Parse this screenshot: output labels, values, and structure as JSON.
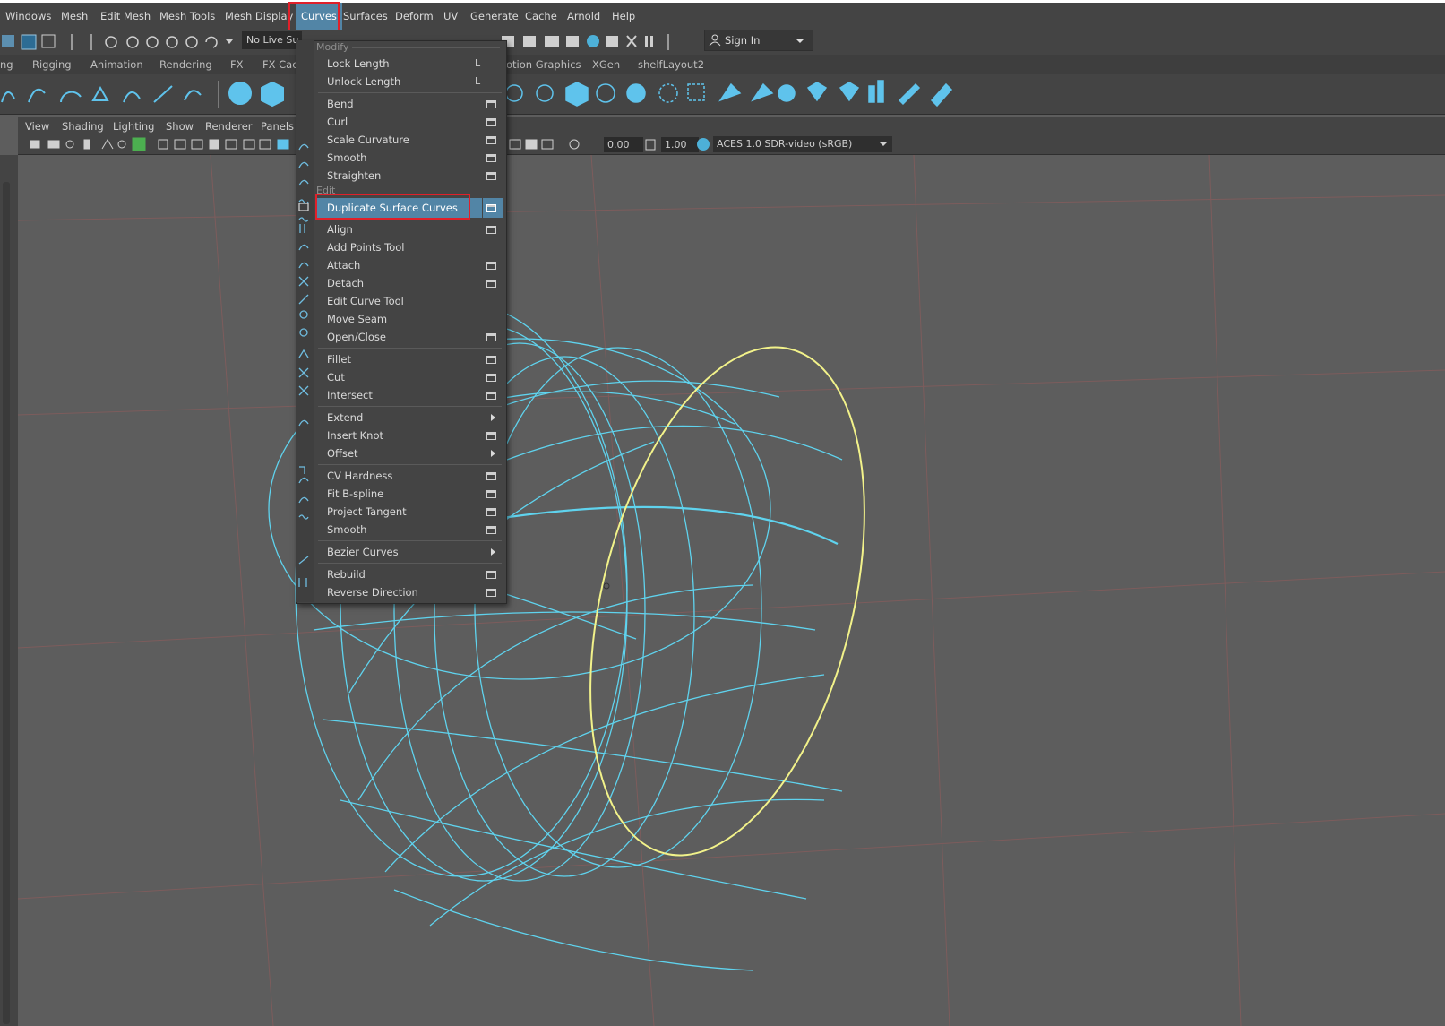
{
  "menubar": {
    "items": [
      "Windows",
      "Mesh",
      "Edit Mesh",
      "Mesh Tools",
      "Mesh Display",
      "Curves",
      "Surfaces",
      "Deform",
      "UV",
      "Generate",
      "Cache",
      "Arnold",
      "Help"
    ],
    "active": "Curves"
  },
  "status_line": {
    "live_surface": "No Live Su",
    "sign_in": "Sign In"
  },
  "shelf_tabs": [
    "ng",
    "Rigging",
    "Animation",
    "Rendering",
    "FX",
    "FX Cach",
    "otion Graphics",
    "XGen",
    "shelfLayout2"
  ],
  "panel_menu": [
    "View",
    "Shading",
    "Lighting",
    "Show",
    "Renderer",
    "Panels"
  ],
  "panel_toolbar": {
    "exposure": "0.00",
    "gamma": "1.00",
    "color_space": "ACES 1.0 SDR-video (sRGB)"
  },
  "curves_menu": {
    "section_modify": "Modify",
    "section_edit": "Edit",
    "items": [
      {
        "label": "Lock Length",
        "key": "L"
      },
      {
        "label": "Unlock Length",
        "key": "L"
      },
      {
        "label": "Bend"
      },
      {
        "label": "Curl"
      },
      {
        "label": "Scale Curvature"
      },
      {
        "label": "Smooth"
      },
      {
        "label": "Straighten"
      },
      {
        "label": "Duplicate Surface Curves"
      },
      {
        "label": "Align"
      },
      {
        "label": "Add Points Tool"
      },
      {
        "label": "Attach"
      },
      {
        "label": "Detach"
      },
      {
        "label": "Edit Curve Tool"
      },
      {
        "label": "Move Seam"
      },
      {
        "label": "Open/Close"
      },
      {
        "label": "Fillet"
      },
      {
        "label": "Cut"
      },
      {
        "label": "Intersect"
      },
      {
        "label": "Extend"
      },
      {
        "label": "Insert Knot"
      },
      {
        "label": "Offset"
      },
      {
        "label": "CV Hardness"
      },
      {
        "label": "Fit B-spline"
      },
      {
        "label": "Project Tangent"
      },
      {
        "label": "Smooth"
      },
      {
        "label": "Bezier Curves"
      },
      {
        "label": "Rebuild"
      },
      {
        "label": "Reverse Direction"
      }
    ],
    "highlighted": "Duplicate Surface Curves"
  },
  "colors": {
    "highlight": "#5285a6",
    "red_annotation": "#e0202a",
    "wireframe": "#5fd3ee",
    "selected_curve": "#f2f28a",
    "grid": "#7a5a5a"
  }
}
